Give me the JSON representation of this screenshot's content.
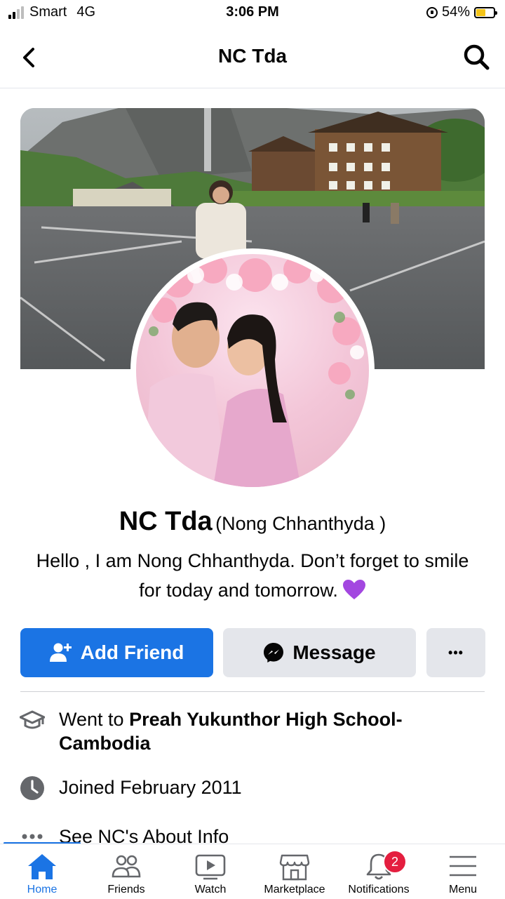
{
  "status_bar": {
    "carrier": "Smart",
    "network": "4G",
    "time": "3:06 PM",
    "battery": "54%"
  },
  "header": {
    "title": "NC Tda",
    "back_icon": "chevron-left-icon",
    "search_icon": "search-icon"
  },
  "profile": {
    "name": "NC Tda",
    "alternate_name": "(Nong Chhanthyda )",
    "bio": "Hello , I am Nong Chhanthyda. Don’t forget to smile for today and tomorrow."
  },
  "actions": {
    "add_friend": "Add Friend",
    "message": "Message",
    "more": "•••"
  },
  "info": {
    "education_prefix": "Went to",
    "education_school": "Preah Yukunthor High School-Cambodia",
    "joined": "Joined February 2011",
    "see_about": "See NC's About Info"
  },
  "nav": {
    "items": [
      {
        "label": "Home",
        "icon": "home-icon",
        "active": true
      },
      {
        "label": "Friends",
        "icon": "friends-icon"
      },
      {
        "label": "Watch",
        "icon": "watch-icon"
      },
      {
        "label": "Marketplace",
        "icon": "marketplace-icon"
      },
      {
        "label": "Notifications",
        "icon": "bell-icon",
        "badge": "2"
      },
      {
        "label": "Menu",
        "icon": "menu-icon"
      }
    ]
  },
  "colors": {
    "accent": "#1b74e4",
    "badge": "#e41e3f",
    "button_gray": "#e4e6eb"
  }
}
